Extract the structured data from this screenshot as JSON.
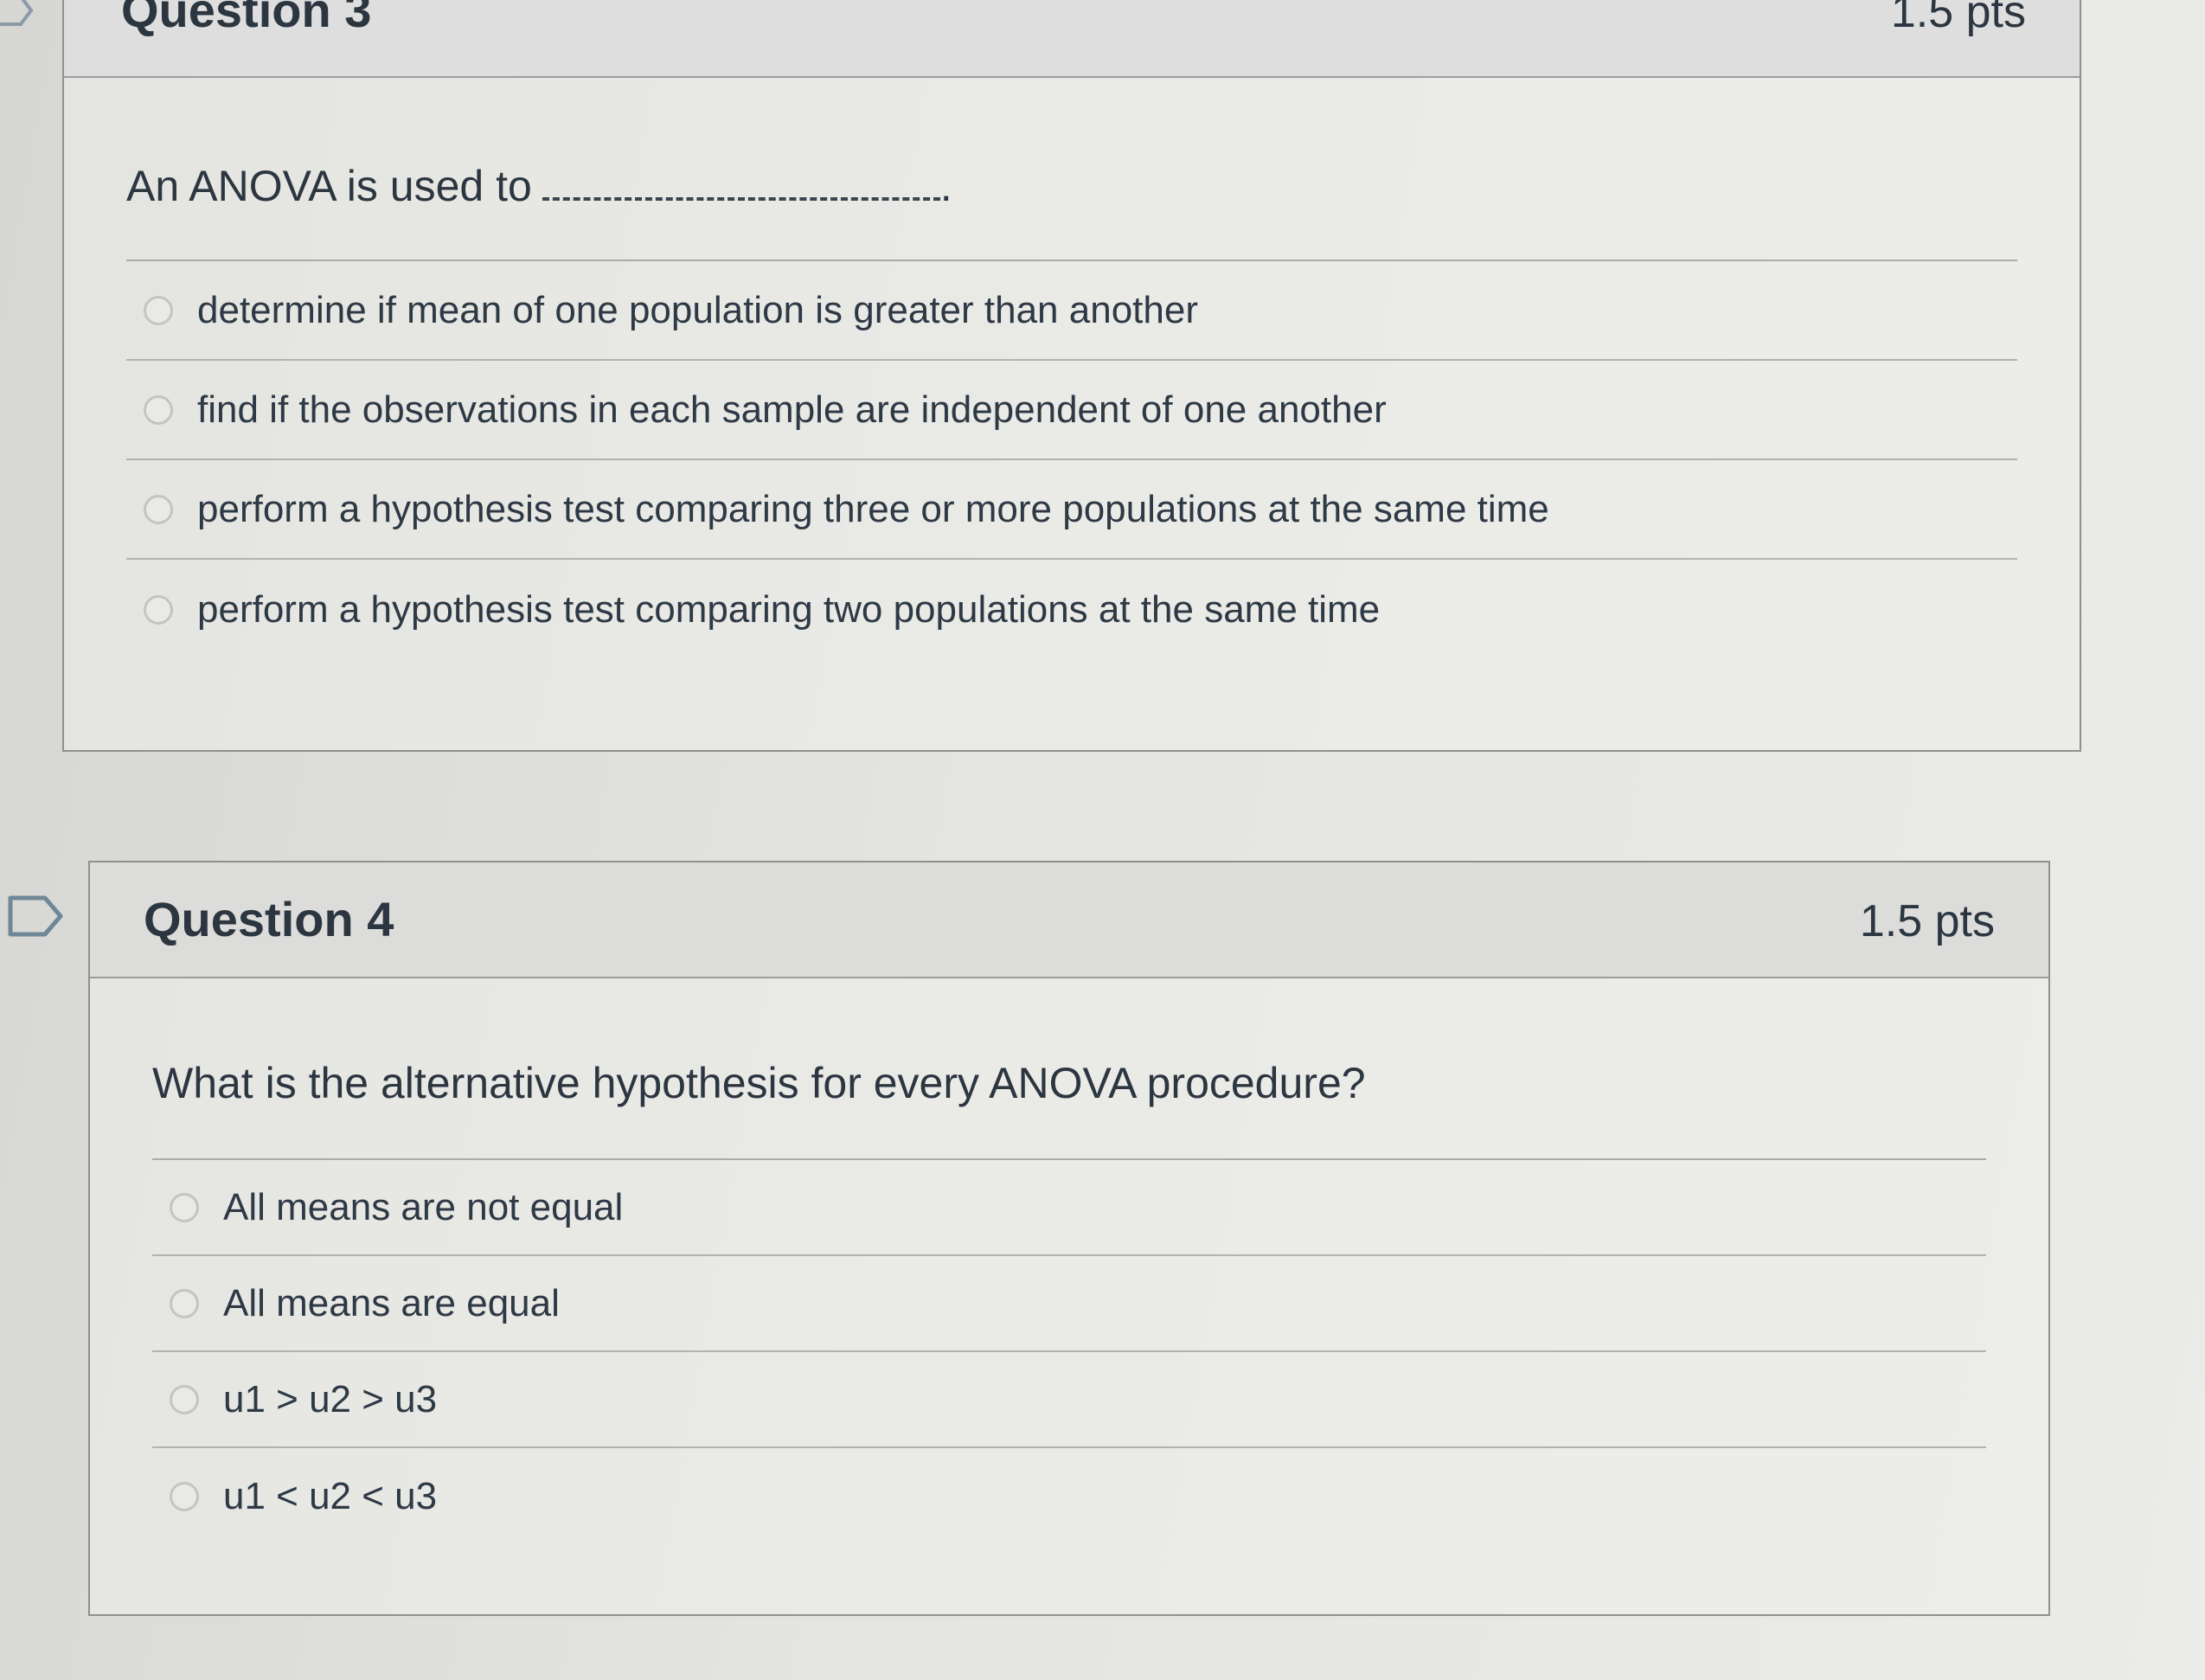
{
  "questions": [
    {
      "title": "Question 3",
      "points": "1.5 pts",
      "prompt": "An ANOVA is used to",
      "prompt_end": ".",
      "answers": [
        "determine if mean of one population is greater than another",
        "find if the observations in each sample are independent of one another",
        "perform a hypothesis test comparing three or more populations at the same time",
        "perform a hypothesis test comparing two populations at the same time"
      ]
    },
    {
      "title": "Question 4",
      "points": "1.5 pts",
      "prompt": "What is the alternative hypothesis for every ANOVA procedure?",
      "answers": [
        "All means are not equal",
        "All means are equal",
        "u1 > u2 > u3",
        "u1 < u2 < u3"
      ]
    }
  ],
  "icons": {
    "flag": "flag-bookmark-icon",
    "radio": "radio-button"
  },
  "colors": {
    "text": "#2c3640",
    "header_bg": "#dcdcda",
    "border": "#8d918f"
  }
}
